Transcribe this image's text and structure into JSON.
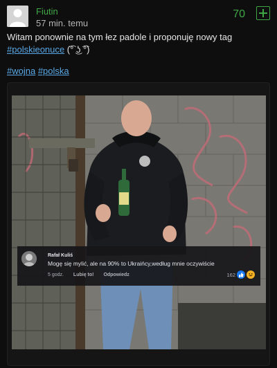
{
  "post": {
    "author": "Fiutin",
    "time": "57 min. temu",
    "votes": "70",
    "text": "Witam ponownie na tym łez padole i proponuję nowy tag",
    "inline_tag": "#polskieonuce",
    "emoticon": " (͡° ͜ʖ ͡°)",
    "tags": [
      "#wojna",
      "#polska"
    ]
  },
  "embedded_comment": {
    "name": "Rafał Kuliś",
    "text": "Mogę się mylić, ale na 90% to Ukraińcy,według mnie oczywiście",
    "time": "5 godz.",
    "like": "Lubię to!",
    "reply": "Odpowiedz",
    "reactions_count": "162"
  },
  "colors": {
    "accent_green": "#3fa845",
    "tag_blue": "#5aa9e6",
    "background": "#0e0e0e"
  },
  "icons": {
    "plus": "plus-icon",
    "avatar": "user-avatar-icon"
  }
}
